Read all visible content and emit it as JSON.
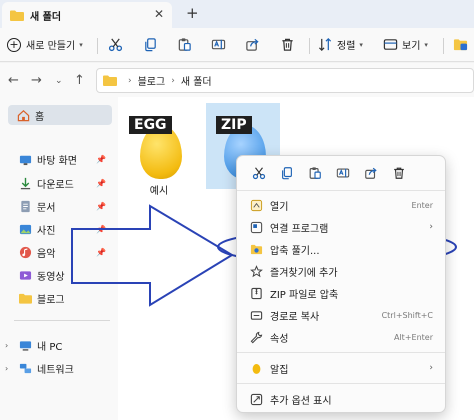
{
  "tab": {
    "title": "새 폴더",
    "close": "✕",
    "new": "+"
  },
  "commandbar": {
    "new_label": "새로 만들기",
    "sort_label": "정렬",
    "view_label": "보기"
  },
  "address": {
    "crumbs": [
      "블로그",
      "새 폴더"
    ]
  },
  "sidebar": {
    "home": "홈",
    "items": [
      {
        "label": "바탕 화면",
        "icon": "desktop-icon",
        "pinned": true
      },
      {
        "label": "다운로드",
        "icon": "download-icon",
        "pinned": true
      },
      {
        "label": "문서",
        "icon": "document-icon",
        "pinned": true
      },
      {
        "label": "사진",
        "icon": "pictures-icon",
        "pinned": true
      },
      {
        "label": "음악",
        "icon": "music-icon",
        "pinned": true
      },
      {
        "label": "동영상",
        "icon": "video-icon",
        "pinned": false
      },
      {
        "label": "블로그",
        "icon": "folder-icon",
        "pinned": false
      }
    ],
    "this_pc": "내 PC",
    "network": "네트워크"
  },
  "files": [
    {
      "name": "예시",
      "badge": "EGG"
    },
    {
      "name": "",
      "badge": "ZIP"
    }
  ],
  "context_menu": {
    "items": [
      {
        "label": "열기",
        "shortcut": "Enter",
        "icon": "open-icon"
      },
      {
        "label": "연결 프로그램",
        "shortcut": "",
        "icon": "open-with-icon",
        "submenu": true
      },
      {
        "label": "압축 풀기...",
        "shortcut": "",
        "icon": "extract-icon"
      },
      {
        "label": "즐겨찾기에 추가",
        "shortcut": "",
        "icon": "star-icon"
      },
      {
        "label": "ZIP 파일로 압축",
        "shortcut": "",
        "icon": "zip-icon"
      },
      {
        "label": "경로로 복사",
        "shortcut": "Ctrl+Shift+C",
        "icon": "copy-path-icon"
      },
      {
        "label": "속성",
        "shortcut": "Alt+Enter",
        "icon": "properties-icon"
      },
      {
        "label": "알집",
        "shortcut": "",
        "icon": "alzip-icon",
        "submenu": true
      },
      {
        "label": "추가 옵션 표시",
        "shortcut": "",
        "icon": "more-options-icon"
      }
    ]
  },
  "colors": {
    "accent": "#2a43b6",
    "selection": "#cce4f7",
    "folder": "#f4c542"
  }
}
